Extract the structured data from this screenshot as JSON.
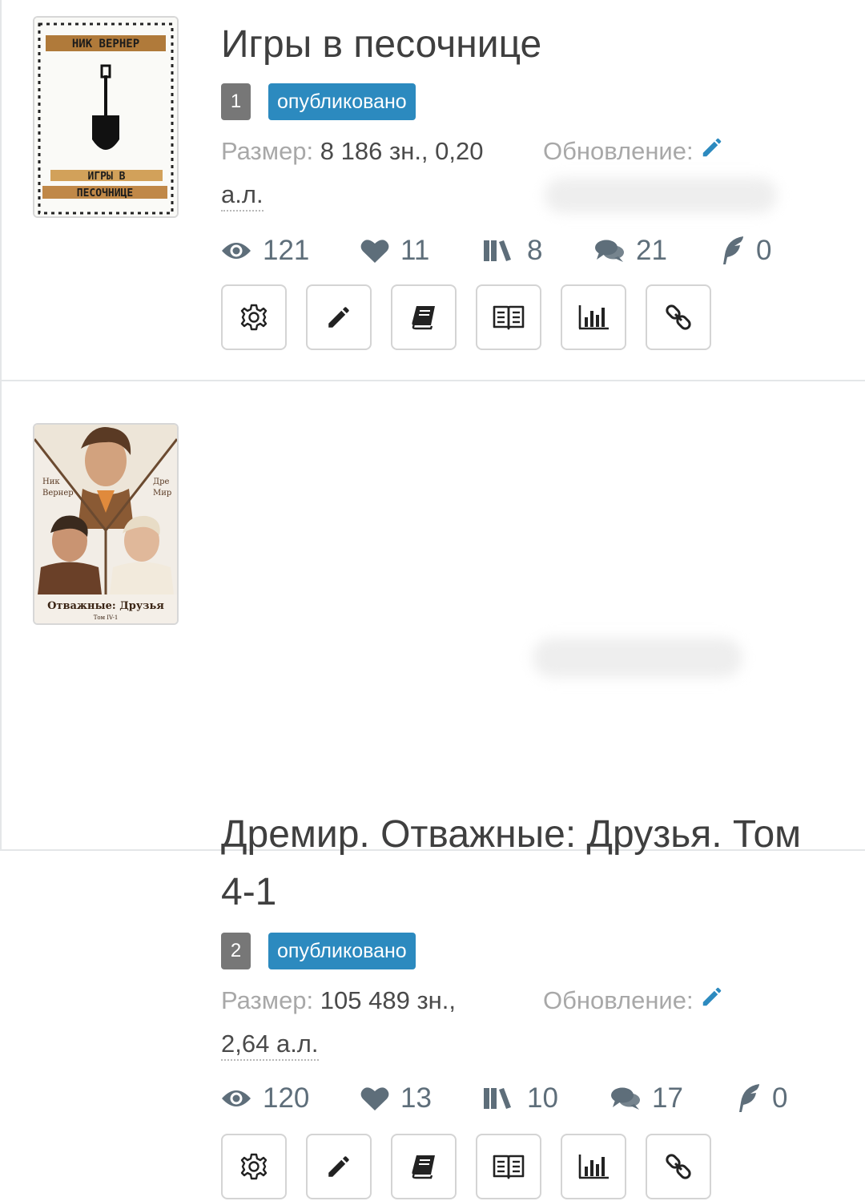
{
  "labels": {
    "size": "Размер:",
    "updated": "Обновление:"
  },
  "colors": {
    "accent": "#2c8abf",
    "order_badge": "#777777",
    "stat_icon": "#5e6e7a"
  },
  "books": [
    {
      "title": "Игры в песочнице",
      "order": "1",
      "status": "опубликовано",
      "size_value": "8 186 зн., 0,20",
      "size_al": "а.л.",
      "cover": {
        "author": "НИК ВЕРНЕР",
        "title_lines": [
          "ИГРЫ В",
          "ПЕСОЧНИЦЕ"
        ]
      },
      "stats": {
        "views": "121",
        "likes": "11",
        "library": "8",
        "comments": "21",
        "rewards": "0"
      }
    },
    {
      "title": "Дремир. Отважные: Друзья. Том 4-1",
      "order": "2",
      "status": "опубликовано",
      "size_value": "105 489 зн.,",
      "size_al": "2,64 а.л.",
      "cover": {
        "author_left": [
          "Ник",
          "Вернер"
        ],
        "author_right": [
          "Дре",
          "Мир"
        ],
        "title": "Отважные: Друзья",
        "volume": "Том IV-1"
      },
      "stats": {
        "views": "120",
        "likes": "13",
        "library": "10",
        "comments": "17",
        "rewards": "0"
      }
    }
  ],
  "icons": {
    "stats": [
      "eye-icon",
      "heart-icon",
      "books-icon",
      "comments-icon",
      "feather-icon"
    ],
    "actions": [
      "gear-icon",
      "pencil-icon",
      "book-icon",
      "open-book-icon",
      "bar-chart-icon",
      "link-icon"
    ]
  }
}
